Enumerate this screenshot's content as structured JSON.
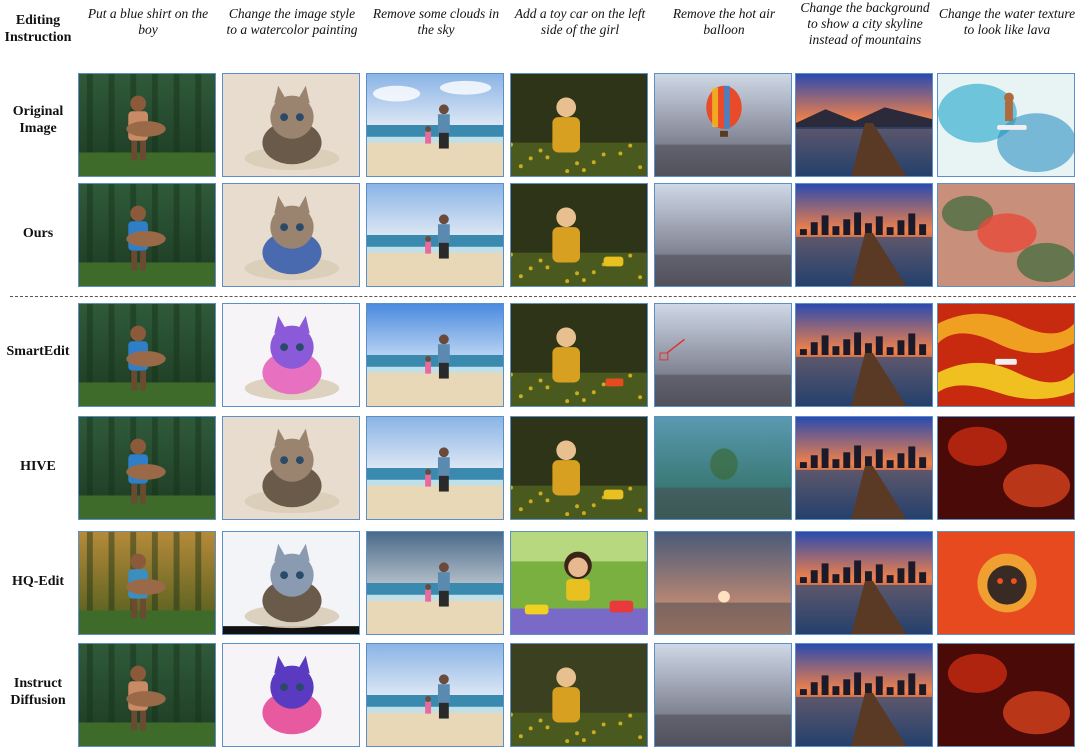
{
  "header": {
    "corner_label": "Editing\nInstruction"
  },
  "instructions": [
    "Put a blue shirt on the boy",
    "Change the image style to a watercolor painting",
    "Remove some clouds in the sky",
    "Add a toy car on the left side of the girl",
    "Remove the hot air balloon",
    "Change the background to show a city skyline instead of mountains",
    "Change the water texture to look like lava"
  ],
  "rows": [
    {
      "label": "Original\nImage"
    },
    {
      "label": "Ours"
    },
    {
      "label": "SmartEdit"
    },
    {
      "label": "HIVE"
    },
    {
      "label": "HQ-Edit"
    },
    {
      "label": "Instruct\nDiffusion"
    }
  ]
}
